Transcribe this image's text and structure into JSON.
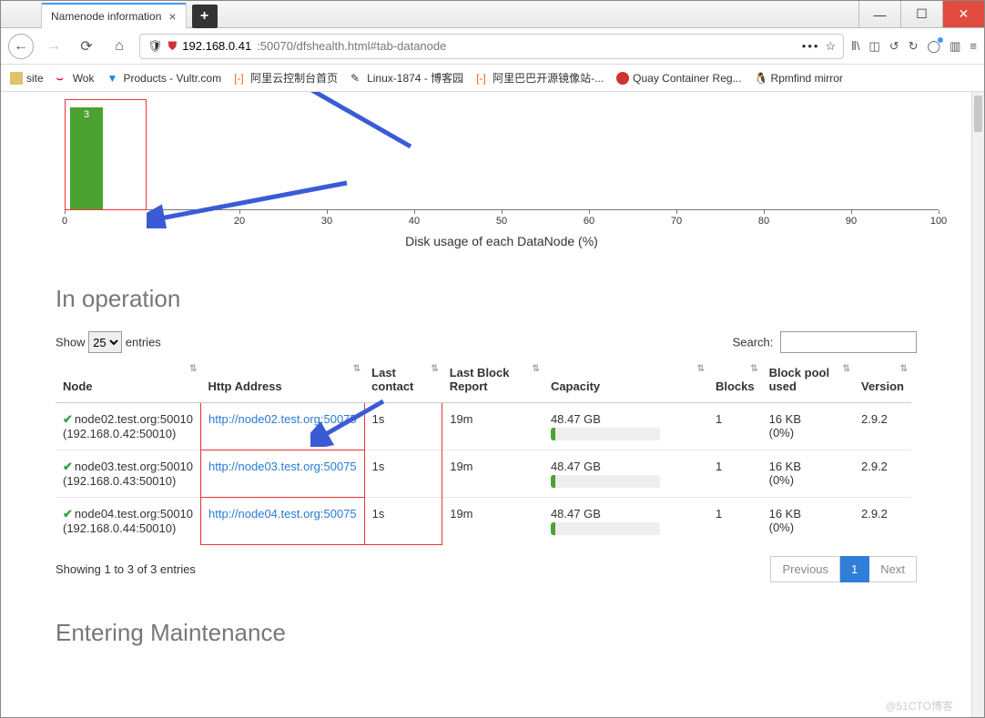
{
  "window": {
    "tab_title": "Namenode information",
    "url_host": "192.168.0.41",
    "url_rest": ":50070/dfshealth.html#tab-datanode"
  },
  "bookmarks": [
    {
      "label": "site"
    },
    {
      "label": "Wok"
    },
    {
      "label": "Products - Vultr.com"
    },
    {
      "label": "阿里云控制台首页"
    },
    {
      "label": "Linux-1874 - 博客园"
    },
    {
      "label": "阿里巴巴开源镜像站-..."
    },
    {
      "label": "Quay Container Reg..."
    },
    {
      "label": "Rpmfind mirror"
    }
  ],
  "chart_data": {
    "type": "bar",
    "categories": [
      "0",
      "10",
      "20",
      "30",
      "40",
      "50",
      "60",
      "70",
      "80",
      "90",
      "100"
    ],
    "values": [
      3
    ],
    "bar_center_percent": 2.5,
    "title": "Disk usage of each DataNode (%)",
    "xlabel": "",
    "ylabel": "",
    "ylim": [
      0,
      3
    ]
  },
  "heading_in_operation": "In operation",
  "heading_entering_maintenance": "Entering Maintenance",
  "dt": {
    "show_label_pre": "Show",
    "show_value": "25",
    "show_label_post": "entries",
    "search_label": "Search:",
    "columns": [
      "Node",
      "Http Address",
      "Last contact",
      "Last Block Report",
      "Capacity",
      "Blocks",
      "Block pool used",
      "Version"
    ],
    "rows": [
      {
        "node": "node02.test.org:50010",
        "ip": "(192.168.0.42:50010)",
        "http": "http://node02.test.org:50075",
        "contact": "1s",
        "lbr": "19m",
        "cap": "48.47 GB",
        "blocks": "1",
        "bpu": "16 KB",
        "bpu_pct": "(0%)",
        "ver": "2.9.2"
      },
      {
        "node": "node03.test.org:50010",
        "ip": "(192.168.0.43:50010)",
        "http": "http://node03.test.org:50075",
        "contact": "1s",
        "lbr": "19m",
        "cap": "48.47 GB",
        "blocks": "1",
        "bpu": "16 KB",
        "bpu_pct": "(0%)",
        "ver": "2.9.2"
      },
      {
        "node": "node04.test.org:50010",
        "ip": "(192.168.0.44:50010)",
        "http": "http://node04.test.org:50075",
        "contact": "1s",
        "lbr": "19m",
        "cap": "48.47 GB",
        "blocks": "1",
        "bpu": "16 KB",
        "bpu_pct": "(0%)",
        "ver": "2.9.2"
      }
    ],
    "info": "Showing 1 to 3 of 3 entries",
    "prev": "Previous",
    "page": "1",
    "next": "Next"
  },
  "watermark": "@51CTO博客"
}
